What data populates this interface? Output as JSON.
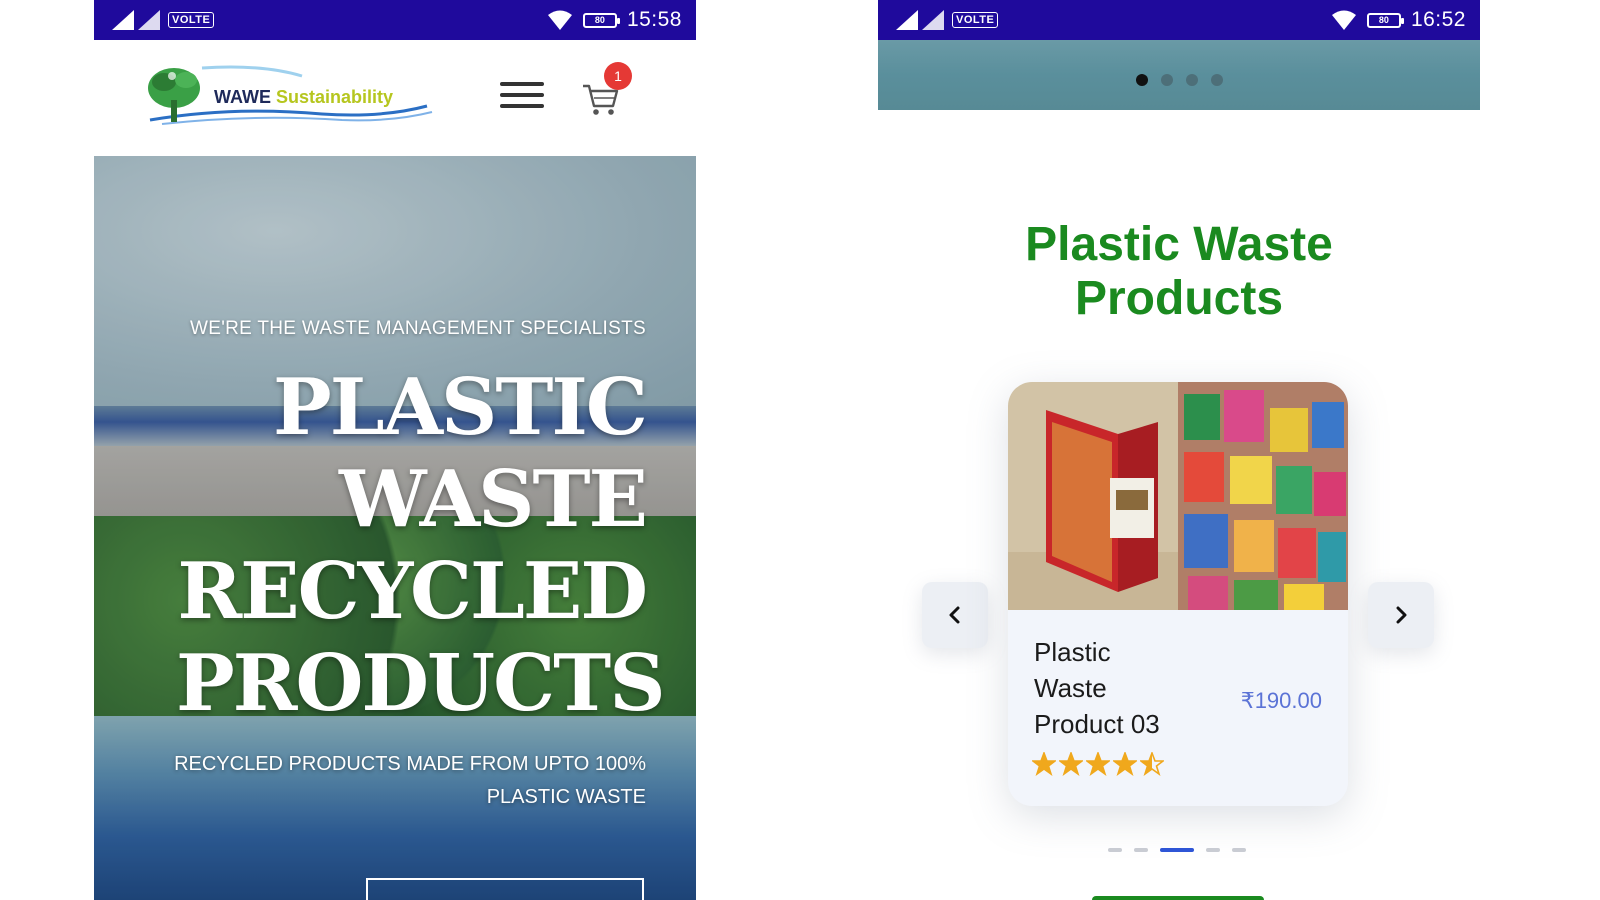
{
  "left_phone": {
    "status_bar": {
      "network_label": "VOLTE",
      "battery_label": "80",
      "time": "15:58"
    },
    "header": {
      "logo": {
        "brand_word": "WAWE",
        "tagline_word": "Sustainability"
      },
      "cart_count": "1"
    },
    "hero": {
      "kicker": "WE'RE THE WASTE MANAGEMENT SPECIALISTS",
      "title_lines": [
        "PLASTIC",
        "WASTE",
        "RECYCLED",
        "PRODUCTS"
      ],
      "subtitle_lines": [
        "RECYCLED PRODUCTS MADE FROM UPTO 100%",
        "PLASTIC WASTE"
      ],
      "button_label": ""
    }
  },
  "right_phone": {
    "status_bar": {
      "network_label": "VOLTE",
      "battery_label": "80",
      "time": "16:52"
    },
    "slider": {
      "dot_count": 4,
      "active_index": 0
    },
    "section": {
      "title_line1": "Plastic Waste",
      "title_line2": "Products"
    },
    "product": {
      "name_lines": [
        "Plastic",
        "Waste",
        "Product 03"
      ],
      "price": "₹190.00",
      "rating": 4.5,
      "rating_max": 5
    },
    "carousel": {
      "dot_count": 5,
      "active_index": 2
    }
  },
  "colors": {
    "status_bar": "#1f0a9c",
    "section_title": "#1a8a1f",
    "price": "#5b73d6",
    "star": "#f0a81c",
    "badge": "#e53935",
    "carousel_active": "#2e55d6"
  },
  "icons": [
    "signal-icon",
    "wifi-icon",
    "battery-icon",
    "menu-icon",
    "cart-icon",
    "chevron-left-icon",
    "chevron-right-icon",
    "star-icon"
  ]
}
